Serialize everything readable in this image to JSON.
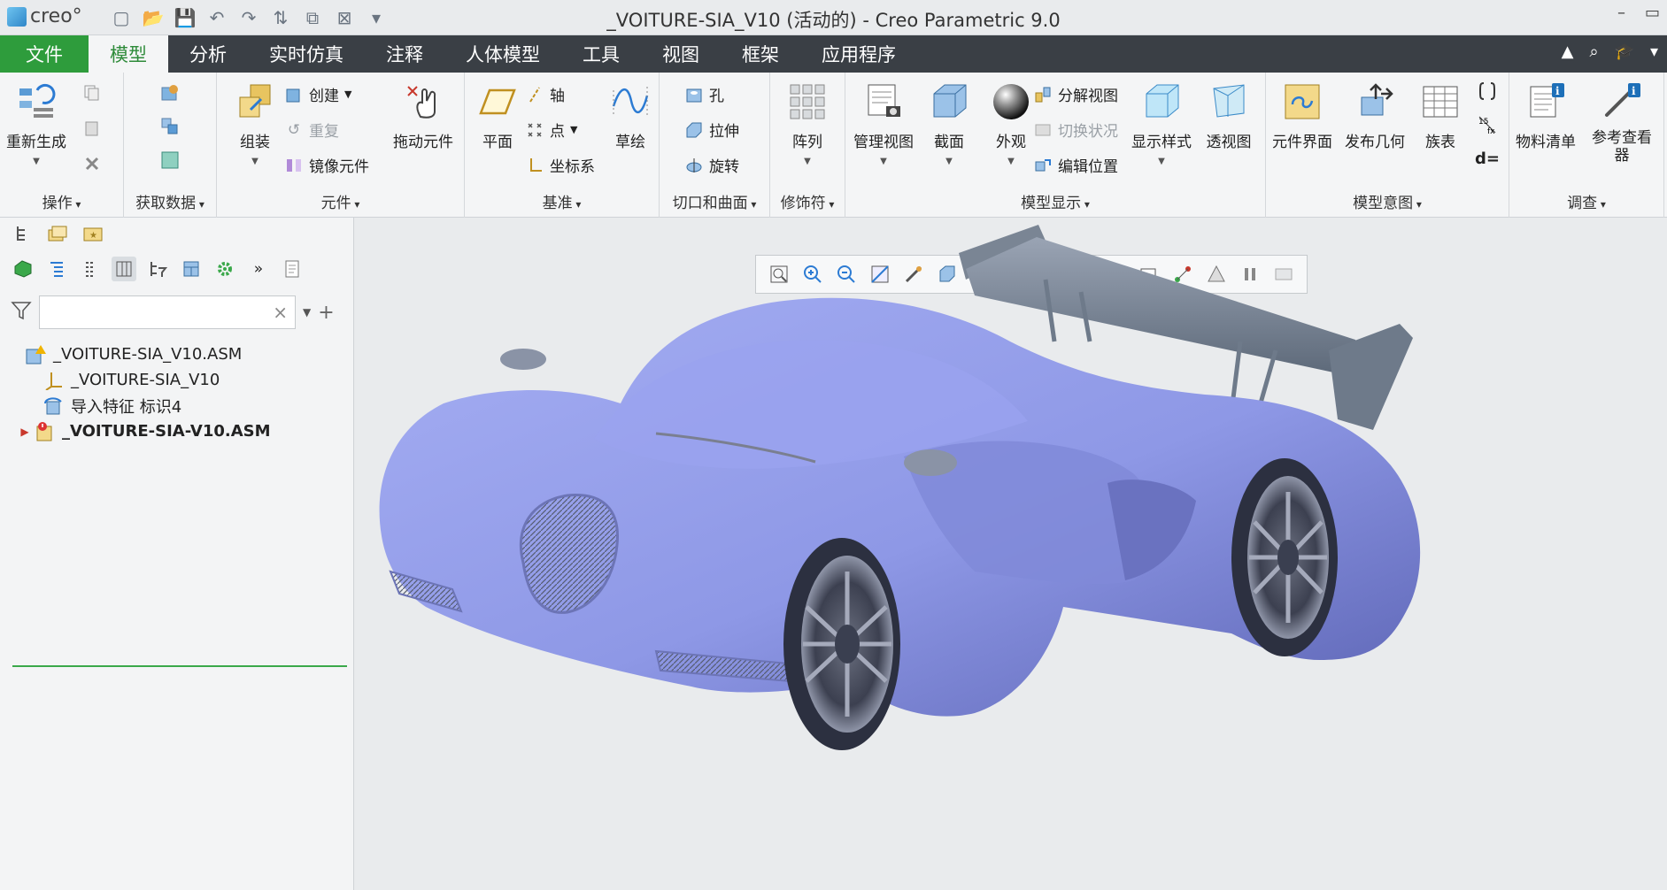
{
  "window": {
    "logo_text": "creo°",
    "title": "_VOITURE-SIA_V10 (活动的) - Creo Parametric 9.0"
  },
  "tabs": [
    {
      "label": "文件"
    },
    {
      "label": "模型"
    },
    {
      "label": "分析"
    },
    {
      "label": "实时仿真"
    },
    {
      "label": "注释"
    },
    {
      "label": "人体模型"
    },
    {
      "label": "工具"
    },
    {
      "label": "视图"
    },
    {
      "label": "框架"
    },
    {
      "label": "应用程序"
    }
  ],
  "ribbon": {
    "operations": {
      "label": "操作",
      "regenerate": "重新生成"
    },
    "get_data": {
      "label": "获取数据"
    },
    "component": {
      "label": "元件",
      "assemble": "组装",
      "create": "创建",
      "repeat": "重复",
      "mirror": "镜像元件",
      "drag": "拖动元件"
    },
    "datum": {
      "label": "基准",
      "plane": "平面",
      "axis": "轴",
      "point": "点",
      "csys": "坐标系",
      "sketch": "草绘"
    },
    "cut_surface": {
      "label": "切口和曲面",
      "hole": "孔",
      "extrude": "拉伸",
      "revolve": "旋转"
    },
    "modifiers": {
      "label": "修饰符",
      "pattern": "阵列"
    },
    "model_display": {
      "label": "模型显示",
      "manage_views": "管理视图",
      "section": "截面",
      "appearance": "外观",
      "explode": "分解视图",
      "toggle_status": "切换状况",
      "edit_position": "编辑位置",
      "display_style": "显示样式",
      "perspective": "透视图"
    },
    "model_intent": {
      "label": "模型意图",
      "interface": "元件界面",
      "publish_geom": "发布几何",
      "family_table": "族表",
      "relations": "d="
    },
    "investigate": {
      "label": "调查",
      "bom": "物料清单",
      "ref_viewer": "参考查看器"
    }
  },
  "model_tree": {
    "search_placeholder": "",
    "items": [
      {
        "label": "_VOITURE-SIA_V10.ASM"
      },
      {
        "label": "_VOITURE-SIA_V10"
      },
      {
        "label": "导入特征 标识4"
      },
      {
        "label": "_VOITURE-SIA-V10.ASM"
      }
    ]
  },
  "colors": {
    "file_tab": "#2e9c3c",
    "tabbar": "#3a3f45",
    "active_tab_text": "#2e8b3a",
    "car_body": "#8e98e6",
    "wing": "#6e7a8a"
  }
}
